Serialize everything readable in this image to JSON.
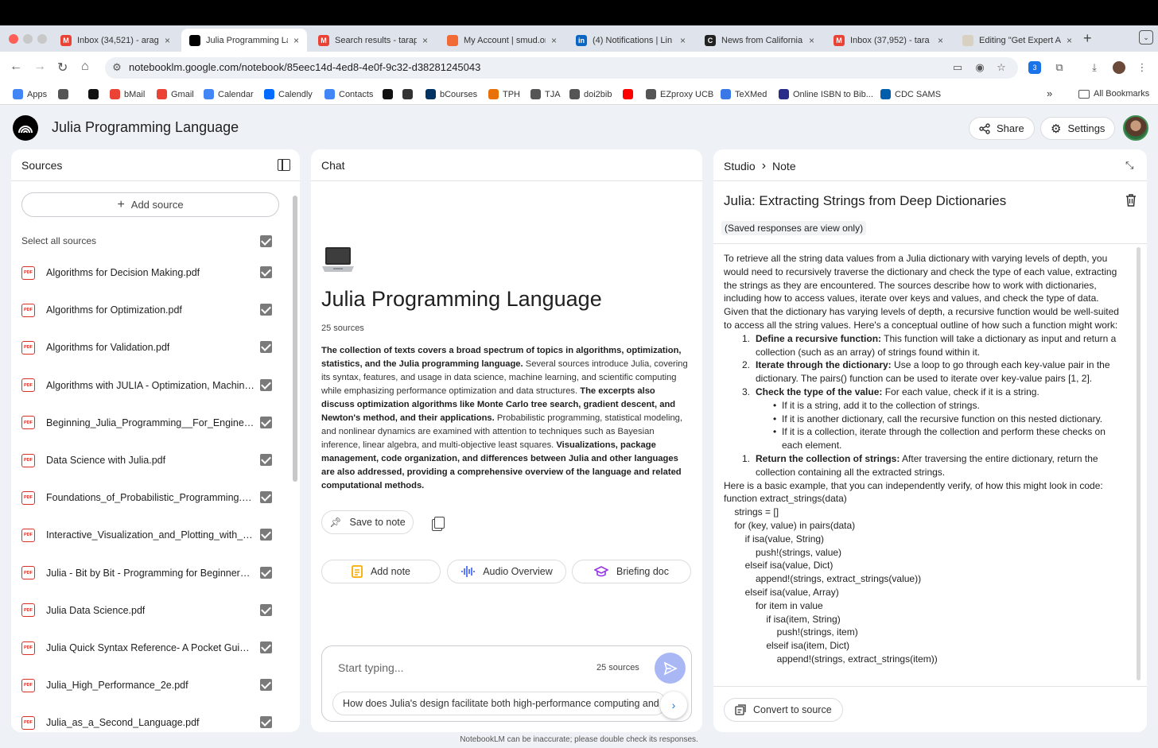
{
  "browser": {
    "tabs": [
      {
        "title": "Inbox (34,521) - arag",
        "fav": "M",
        "color": "#ea4335",
        "active": false
      },
      {
        "title": "Julia Programming La",
        "fav": "",
        "color": "#000000",
        "active": true
      },
      {
        "title": "Search results - tarap",
        "fav": "M",
        "color": "#ea4335",
        "active": false
      },
      {
        "title": "My Account | smud.or",
        "fav": "",
        "color": "#f26a36",
        "active": false
      },
      {
        "title": "(4) Notifications | Lin",
        "fav": "in",
        "color": "#0a66c2",
        "active": false
      },
      {
        "title": "News from California",
        "fav": "C",
        "color": "#222222",
        "active": false
      },
      {
        "title": "Inbox (37,952) - tara",
        "fav": "M",
        "color": "#ea4335",
        "active": false
      },
      {
        "title": "Editing \"Get Expert A",
        "fav": "",
        "color": "#d8d0c0",
        "active": false
      }
    ],
    "url": "notebooklm.google.com/notebook/85eec14d-4ed8-4e0f-9c32-d38281245043",
    "extension_badge": "3",
    "bookmarks": [
      {
        "label": "Apps",
        "icon": "grid-icon",
        "color": "#4285f4"
      },
      {
        "label": "",
        "icon": "grid-icon",
        "color": "#555555"
      },
      {
        "label": "",
        "icon": "amazon-icon",
        "color": "#111111"
      },
      {
        "label": "bMail",
        "icon": "gmail-icon",
        "color": "#ea4335"
      },
      {
        "label": "Gmail",
        "icon": "gmail-icon",
        "color": "#ea4335"
      },
      {
        "label": "Calendar",
        "icon": "calendar-icon",
        "color": "#4285f4"
      },
      {
        "label": "Calendly",
        "icon": "calendly-icon",
        "color": "#006bff"
      },
      {
        "label": "Contacts",
        "icon": "contacts-icon",
        "color": "#4285f4"
      },
      {
        "label": "",
        "icon": "amazon-icon",
        "color": "#111111"
      },
      {
        "label": "",
        "icon": "arrow-icon",
        "color": "#333333"
      },
      {
        "label": "bCourses",
        "icon": "cal-icon",
        "color": "#003262"
      },
      {
        "label": "TPH",
        "icon": "tph-icon",
        "color": "#e8710a"
      },
      {
        "label": "TJA",
        "icon": "globe-icon",
        "color": "#555555"
      },
      {
        "label": "doi2bib",
        "icon": "doc-icon",
        "color": "#555555"
      },
      {
        "label": "",
        "icon": "youtube-icon",
        "color": "#ff0000"
      },
      {
        "label": "EZproxy UCB",
        "icon": "globe-icon",
        "color": "#555555"
      },
      {
        "label": "TeXMed",
        "icon": "texmed-icon",
        "color": "#3b78e7"
      },
      {
        "label": "Online ISBN to Bib...",
        "icon": "p-icon",
        "color": "#2b2b8a"
      },
      {
        "label": "CDC SAMS",
        "icon": "cdc-icon",
        "color": "#005eaa"
      }
    ],
    "more_bookmarks": "»",
    "all_bookmarks": "All Bookmarks"
  },
  "app": {
    "title": "Julia Programming Language",
    "share_label": "Share",
    "settings_label": "Settings"
  },
  "sources": {
    "header": "Sources",
    "add_label": "Add source",
    "select_all": "Select all sources",
    "items": [
      "Algorithms for Decision Making.pdf",
      "Algorithms for Optimization.pdf",
      "Algorithms for Validation.pdf",
      "Algorithms with JULIA - Optimization, Machine Learning.pdf",
      "Beginning_Julia_Programming__For_Engineers_and_Scientists.pdf",
      "Data Science with Julia.pdf",
      "Foundations_of_Probabilistic_Programming.pdf",
      "Interactive_Visualization_and_Plotting_with_Julia.pdf",
      "Julia - Bit by Bit - Programming for Beginners.pdf",
      "Julia Data Science.pdf",
      "Julia Quick Syntax Reference- A Pocket Guide.pdf",
      "Julia_High_Performance_2e.pdf",
      "Julia_as_a_Second_Language.pdf"
    ]
  },
  "chat": {
    "header": "Chat",
    "notebook_title": "Julia Programming Language",
    "source_count": "25 sources",
    "summary": [
      {
        "text": "The collection of texts covers a broad spectrum of topics in algorithms, optimization, statistics, and the Julia programming language.",
        "bold": true
      },
      {
        "text": " Several sources introduce Julia, covering its syntax, features, and usage in data science, machine learning, and scientific computing while emphasizing performance optimization and data structures. ",
        "bold": false
      },
      {
        "text": "The excerpts also discuss optimization algorithms like Monte Carlo tree search, gradient descent, and Newton's method, and their applications.",
        "bold": true
      },
      {
        "text": " Probabilistic programming, statistical modeling, and nonlinear dynamics are examined with attention to techniques such as Bayesian inference, linear algebra, and multi-objective least squares. ",
        "bold": false
      },
      {
        "text": "Visualizations, package management, code organization, and differences between Julia and other languages are also addressed, providing a comprehensive overview of the language and related computational methods.",
        "bold": true
      }
    ],
    "save_to_note": "Save to note",
    "add_note": "Add note",
    "audio_overview": "Audio Overview",
    "briefing_doc": "Briefing doc",
    "input_placeholder": "Start typing...",
    "input_sources": "25 sources",
    "suggestion": "How does Julia's design facilitate both high-performance computing and"
  },
  "studio": {
    "crumb_root": "Studio",
    "crumb_leaf": "Note",
    "note_title": "Julia: Extracting Strings from Deep Dictionaries",
    "view_only": "(Saved responses are view only)",
    "intro": "To retrieve all the string data values from a Julia dictionary with varying levels of depth, you would need to recursively traverse the dictionary and check the type of each value, extracting the strings as they are encountered. The sources describe how to work with dictionaries, including how to access values, iterate over keys and values, and check the type of data.",
    "para2": "Given that the dictionary has varying levels of depth, a recursive function would be well-suited to access all the string values. Here's a conceptual outline of how such a function might work:",
    "steps": [
      {
        "num": "1.",
        "title": "Define a recursive function:",
        "text": " This function will take a dictionary as input and return a collection (such as an array) of strings found within it."
      },
      {
        "num": "2.",
        "title": "Iterate through the dictionary:",
        "text": " Use a loop to go through each key-value pair in the dictionary. The pairs() function can be used to iterate over key-value pairs [1, 2]."
      },
      {
        "num": "3.",
        "title": "Check the type of the value:",
        "text": " For each value, check if it is a string."
      }
    ],
    "bullets": [
      "If it is a string, add it to the collection of strings.",
      "If it is another dictionary, call the recursive function on this nested dictionary.",
      "If it is a collection, iterate through the collection and perform these checks on each element."
    ],
    "step_final": {
      "num": "1.",
      "title": "Return the collection of strings:",
      "text": " After traversing the entire dictionary, return the collection containing all the extracted strings."
    },
    "code_intro": "Here is a basic example, that you can independently verify, of how this might look in code:",
    "code": [
      "function extract_strings(data)",
      "    strings = []",
      "    for (key, value) in pairs(data)",
      "        if isa(value, String)",
      "            push!(strings, value)",
      "        elseif isa(value, Dict)",
      "            append!(strings, extract_strings(value))",
      "        elseif isa(value, Array)",
      "            for item in value",
      "                if isa(item, String)",
      "                    push!(strings, item)",
      "                elseif isa(item, Dict)",
      "                    append!(strings, extract_strings(item))"
    ],
    "convert_label": "Convert to source"
  },
  "footer": "NotebookLM can be inaccurate; please double check its responses."
}
